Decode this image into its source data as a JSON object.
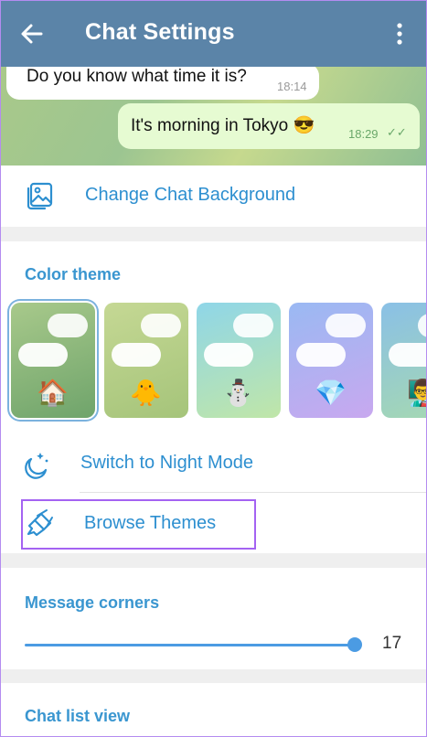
{
  "header": {
    "title": "Chat Settings"
  },
  "preview": {
    "incoming": {
      "text": "Do you know what time it is?",
      "time": "18:14"
    },
    "outgoing": {
      "text": "It's morning in Tokyo 😎",
      "time": "18:29",
      "status": "✓✓"
    }
  },
  "background": {
    "label": "Change Chat Background"
  },
  "color_theme": {
    "title": "Color theme",
    "themes": [
      {
        "emoji": "🏠",
        "selected": true,
        "colors": [
          "#a8c98b",
          "#6fa46b"
        ]
      },
      {
        "emoji": "🐥",
        "selected": false,
        "colors": [
          "#c5d894",
          "#a5c47a"
        ]
      },
      {
        "emoji": "⛄",
        "selected": false,
        "colors": [
          "#8fd6e8",
          "#c0e6a8"
        ]
      },
      {
        "emoji": "💎",
        "selected": false,
        "colors": [
          "#9ab9f3",
          "#c8a8ef"
        ]
      },
      {
        "emoji": "👨‍🏫",
        "selected": false,
        "colors": [
          "#8ac0e6",
          "#a6d9b0"
        ]
      }
    ]
  },
  "night_mode": {
    "label": "Switch to Night Mode"
  },
  "browse": {
    "label": "Browse Themes"
  },
  "corners": {
    "title": "Message corners",
    "value": "17",
    "fraction": 0.97
  },
  "chat_list": {
    "title": "Chat list view"
  },
  "colors": {
    "accent": "#2d8fd0",
    "header": "#5b84a8",
    "highlight": "#a463f2"
  }
}
